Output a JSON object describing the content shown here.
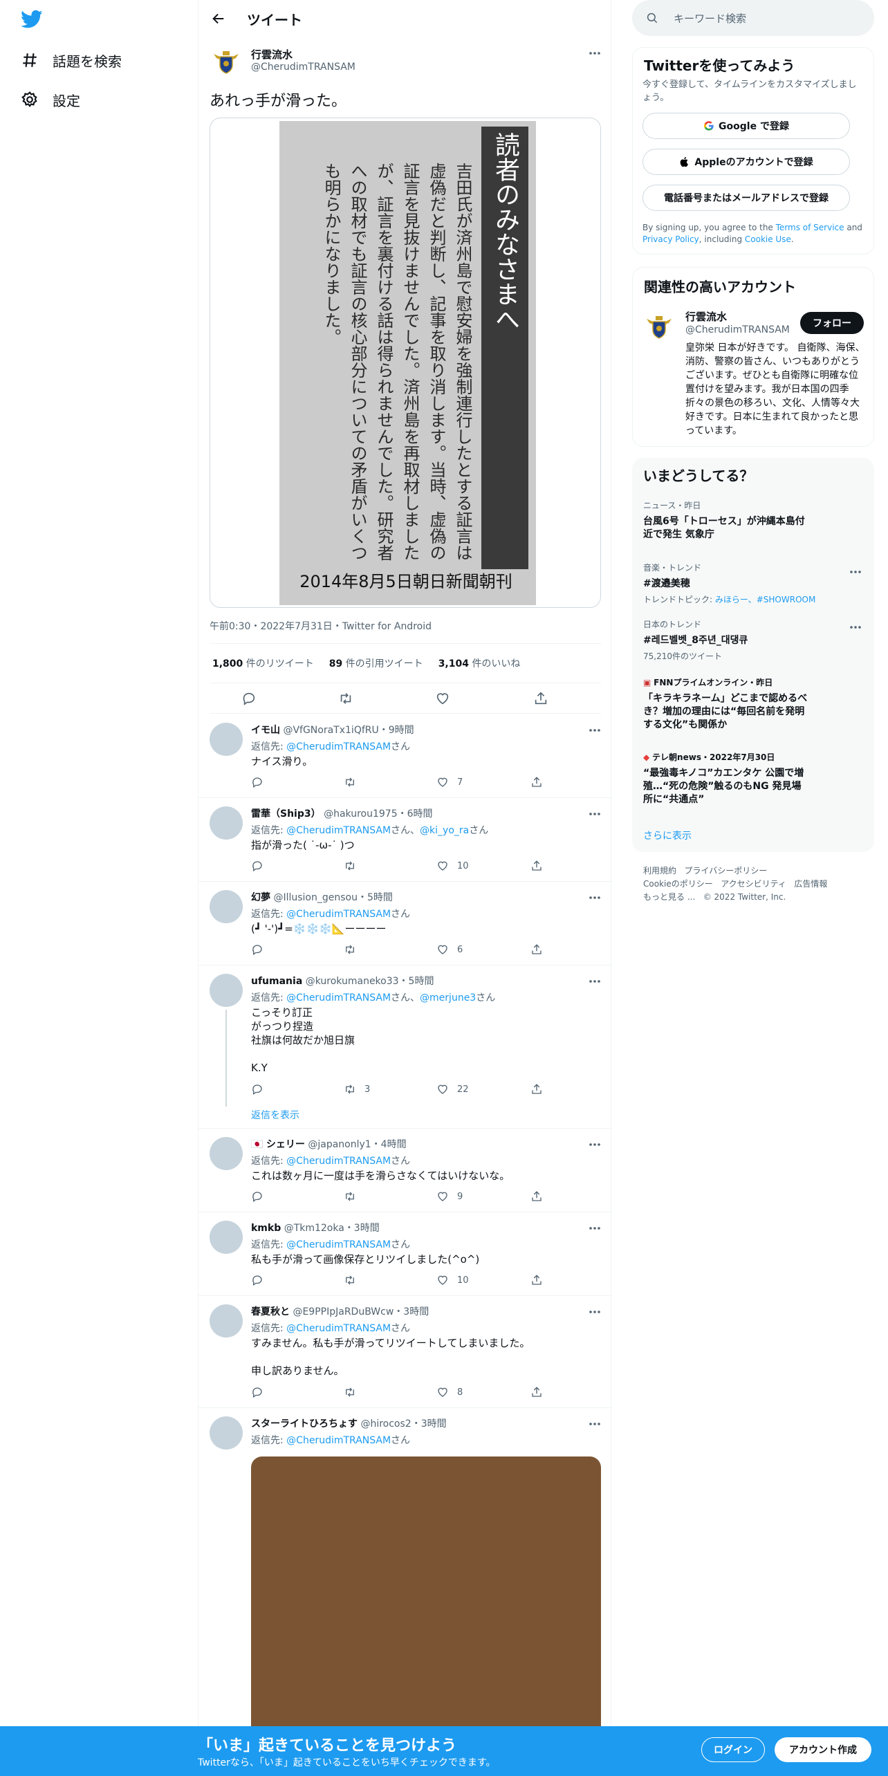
{
  "colors": {
    "accent": "#1d9bf0",
    "text": "#0f1419",
    "muted": "#536471",
    "border": "#eff3f4"
  },
  "nav": {
    "explore": "話題を検索",
    "settings": "設定"
  },
  "header": {
    "title": "ツイート"
  },
  "tweet": {
    "name": "行雲流水",
    "handle": "@CherudimTRANSAM",
    "text": "あれっ手が滑った。",
    "media_caption": "2014年8月5日朝日新聞朝刊",
    "paper_heading": "読者のみなさまへ",
    "paper_body": "吉田氏が済州島で慰安婦を強制連行したとする証言は虚偽だと判断し、記事を取り消します。当時、虚偽の証言を見抜けませんでした。済州島を再取材しましたが、証言を裏付ける話は得られませんでした。研究者への取材でも証言の核心部分についての矛盾がいくつも明らかになりました。",
    "timestamp": "午前0:30・2022年7月31日・Twitter for Android",
    "retweets": "1,800",
    "retweets_label": "件のリツイート",
    "quotes": "89",
    "quotes_label": "件の引用ツイート",
    "likes": "3,104",
    "likes_label": "件のいいね"
  },
  "replies": [
    {
      "name": "イモ山",
      "handle": "@VfGNoraTx1iQfRU",
      "time": "・9時間",
      "to_prefix": "返信先: ",
      "to": "@CherudimTRANSAM",
      "to_suffix": "さん",
      "text": "ナイス滑り。",
      "likes": "7"
    },
    {
      "name": "雷華（Ship3）",
      "handle": "@hakurou1975",
      "time": "・6時間",
      "to_prefix": "返信先: ",
      "to": "@CherudimTRANSAM",
      "to_mid": "さん、",
      "to2": "@ki_yo_ra",
      "to_suffix": "さん",
      "text": "指が滑った( ˙-ω-˙ )つ",
      "likes": "10"
    },
    {
      "name": "幻夢",
      "handle": "@Illusion_gensou",
      "time": "・5時間",
      "to_prefix": "返信先: ",
      "to": "@CherudimTRANSAM",
      "to_suffix": "さん",
      "text": "(┛ '-')┛=❄️❄️❄️📐ーーーー",
      "likes": "6"
    },
    {
      "name": "ufumania",
      "handle": "@kurokumaneko33",
      "time": "・5時間",
      "to_prefix": "返信先: ",
      "to": "@CherudimTRANSAM",
      "to_mid": "さん、",
      "to2": "@merjune3",
      "to_suffix": "さん",
      "text": "こっそり訂正\nがっつり捏造\n社旗は何故だか旭日旗\n\nK.Y",
      "retweets": "3",
      "likes": "22",
      "show_replies": "返信を表示"
    },
    {
      "name": "シェリー",
      "flag": "🇯🇵",
      "handle": "@japanonly1",
      "time": "・4時間",
      "to_prefix": "返信先: ",
      "to": "@CherudimTRANSAM",
      "to_suffix": "さん",
      "text": "これは数ヶ月に一度は手を滑らさなくてはいけないな。",
      "likes": "9"
    },
    {
      "name": "kmkb",
      "handle": "@Tkm12oka",
      "time": "・3時間",
      "to_prefix": "返信先: ",
      "to": "@CherudimTRANSAM",
      "to_suffix": "さん",
      "text": "私も手が滑って画像保存とリツイしました(^o^)",
      "likes": "10"
    },
    {
      "name": "春夏秋と",
      "handle": "@E9PPIpJaRDuBWcw",
      "time": "・3時間",
      "to_prefix": "返信先: ",
      "to": "@CherudimTRANSAM",
      "to_suffix": "さん",
      "text": "すみません。私も手が滑ってリツイートしてしまいました。\n\n申し訳ありません。",
      "likes": "8"
    },
    {
      "name": "スターライトひろちょす",
      "handle": "@hirocos2",
      "time": "・3時間",
      "to_prefix": "返信先: ",
      "to": "@CherudimTRANSAM",
      "to_suffix": "さん"
    }
  ],
  "search": {
    "placeholder": "キーワード検索"
  },
  "signup": {
    "title": "Twitterを使ってみよう",
    "subtitle": "今すぐ登録して、タイムラインをカスタマイズしましょう。",
    "google": "Google で登録",
    "apple": "Appleのアカウントで登録",
    "phone": "電話番号またはメールアドレスで登録",
    "terms_1": "By signing up, you agree to the ",
    "terms_link1": "Terms of Service",
    "terms_2": " and ",
    "terms_link2": "Privacy Policy",
    "terms_3": ", including ",
    "terms_link3": "Cookie Use",
    "terms_4": "."
  },
  "related": {
    "title": "関連性の高いアカウント",
    "name": "行雲流水",
    "handle": "@CherudimTRANSAM",
    "follow": "フォロー",
    "bio": "皇弥栄 日本が好きです。 自衛隊、海保、消防、警察の皆さん、いつもありがとうございます。ぜひとも自衛隊に明確な位置付けを望みます。我が日本国の四季折々の景色の移ろい、文化、人情等々大好きです。日本に生まれて良かったと思っています。"
  },
  "trends": {
    "title": "いまどうしてる？",
    "items": [
      {
        "meta": "ニュース・昨日",
        "title": "台風6号「トローセス」が沖縄本島付近で発生 気象庁"
      },
      {
        "meta": "音楽・トレンド",
        "title": "#渡邉美穂",
        "sub_prefix": "トレンドトピック: ",
        "sub_link": "みほらー、#SHOWROOM"
      },
      {
        "meta": "日本のトレンド",
        "title": "#레드벨벳_8주년_대댕큐",
        "sub": "75,210件のツイート"
      },
      {
        "meta": "FNNプライムオンライン・昨日",
        "title": "「キラキラネーム」どこまで認めるべき？増加の理由には“毎回名前を発明する文化”も関係か"
      },
      {
        "meta": "テレ朝news・2022年7月30日",
        "title": "“最強毒キノコ”カエンタケ 公園で増殖…“死の危険”触るのもNG 発見場所に“共通点”"
      }
    ],
    "more": "さらに表示"
  },
  "footer": {
    "links": [
      "利用規約",
      "プライバシーポリシー",
      "Cookieのポリシー",
      "アクセシビリティ",
      "広告情報",
      "もっと見る ..."
    ],
    "copyright": "© 2022 Twitter, Inc."
  },
  "bottombar": {
    "title": "「いま」起きていることを見つけよう",
    "subtitle": "Twitterなら、「いま」起きていることをいち早くチェックできます。",
    "login": "ログイン",
    "signup": "アカウント作成"
  }
}
